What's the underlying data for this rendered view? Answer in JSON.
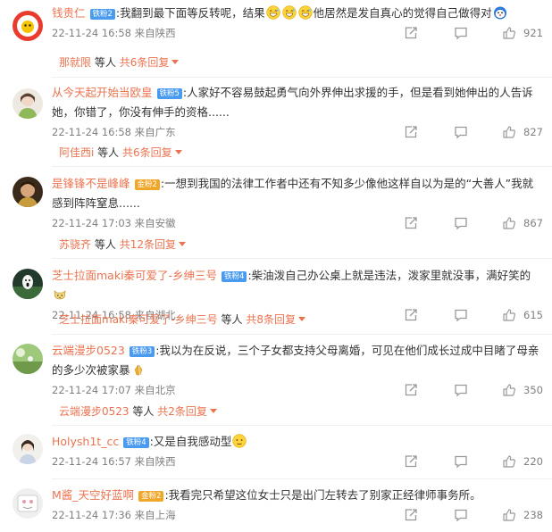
{
  "colors": {
    "accent": "#eb7350",
    "badge_blue": "#4a9bf0",
    "badge_gold": "#f0a629",
    "meta": "#808080"
  },
  "comments": [
    {
      "user": "钱贵仁",
      "badge": "铁粉2",
      "badge_color": "blue",
      "text_a": ":我翻到最下面等反转呢，结果",
      "text_b": "他居然是发自真心的觉得自己做得对",
      "time": "22-11-24 16:58 来自陕西",
      "likes": "921",
      "reply_user": "那就限",
      "reply_mid": "等人",
      "reply_count": "共6条回复"
    },
    {
      "user": "从今天起开始当欧皇",
      "badge": "铁粉5",
      "badge_color": "blue",
      "text": ":人家好不容易鼓起勇气向外界伸出求援的手，但是看到她伸出的人告诉她，你错了，你没有伸手的资格......",
      "time": "22-11-24 16:58 来自广东",
      "likes": "827",
      "reply_user": "阿佳西i",
      "reply_mid": "等人",
      "reply_count": "共6条回复"
    },
    {
      "user": "是锋锋不是峰峰",
      "badge": "金粉2",
      "badge_color": "gold",
      "text": ":一想到我国的法律工作者中还有不知多少像他这样自以为是的“大善人”我就感到阵阵窒息......",
      "time": "22-11-24 17:03 来自安徽",
      "likes": "867",
      "reply_user": "苏骁齐",
      "reply_mid": "等人",
      "reply_count": "共12条回复"
    },
    {
      "user": "芝士拉面maki秦可爱了-乡绅三号",
      "badge": "铁粉4",
      "badge_color": "blue",
      "text": ":柴油泼自己办公桌上就是违法，泼家里就没事，满好笑的",
      "time": "22-11-24 16:58 来自湖北",
      "likes": "615",
      "reply_user": "芝士拉面maki秦可爱了-乡绅三号",
      "reply_mid": "等人",
      "reply_count": "共8条回复"
    },
    {
      "user": "云端漫步0523",
      "badge": "铁粉3",
      "badge_color": "blue",
      "text": ":我以为在反说，三个子女都支持父母离婚，可见在他们成长过成中目睹了母亲的多少次被家暴",
      "time": "22-11-24 17:07 来自北京",
      "likes": "350",
      "reply_user": "云端漫步0523",
      "reply_mid": "等人",
      "reply_count": "共2条回复"
    },
    {
      "user": "Holysh1t_cc",
      "badge": "铁粉4",
      "badge_color": "blue",
      "text": ":又是自我感动型",
      "time": "22-11-24 16:57 来自陕西",
      "likes": "220"
    },
    {
      "user": "M酱_天空好蓝啊",
      "badge": "金粉2",
      "badge_color": "gold",
      "text": ":我看完只希望这位女士只是出门左转去了别家正经律师事务所。",
      "time": "22-11-24 17:36 来自上海",
      "likes": "238"
    }
  ]
}
